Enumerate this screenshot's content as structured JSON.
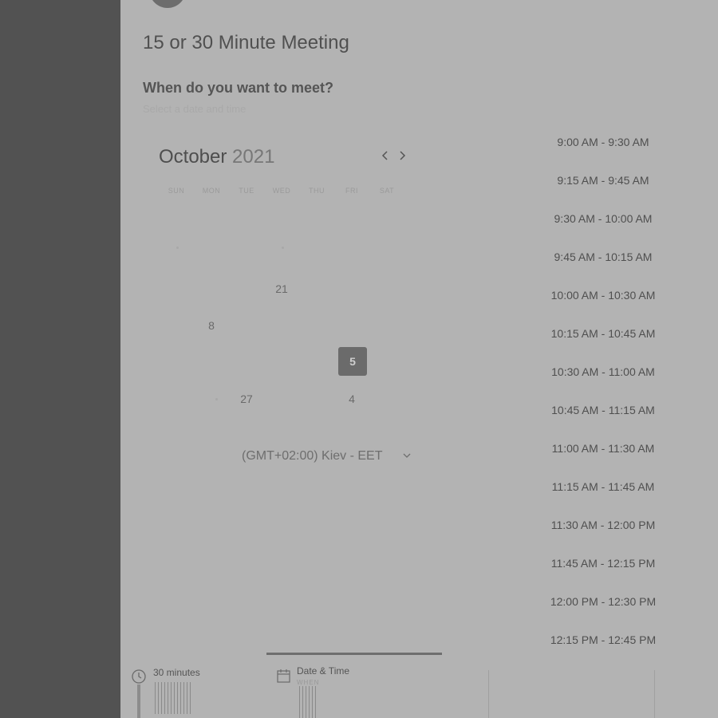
{
  "meeting": {
    "title": "15 or 30 Minute Meeting",
    "question": "When do you want to meet?",
    "hint": "Select a date and time"
  },
  "calendar": {
    "month": "October",
    "year": "2021",
    "prev_icon": "chevron-left",
    "next_icon": "chevron-right",
    "weekdays": [
      "SUN",
      "MON",
      "TUE",
      "WED",
      "THU",
      "FRI",
      "SAT"
    ],
    "visible_days": [
      "21",
      "8",
      "5",
      "27",
      "4"
    ],
    "selected_day": "5",
    "timezone": "(GMT+02:00) Kiev - EET",
    "timezone_icon": "chevron-down"
  },
  "slots": [
    "9:00 AM - 9:30 AM",
    "9:15 AM - 9:45 AM",
    "9:30 AM - 10:00 AM",
    "9:45 AM - 10:15 AM",
    "10:00 AM - 10:30 AM",
    "10:15 AM - 10:45 AM",
    "10:30 AM - 11:00 AM",
    "10:45 AM - 11:15 AM",
    "11:00 AM - 11:30 AM",
    "11:15 AM - 11:45 AM",
    "11:30 AM - 12:00 PM",
    "11:45 AM - 12:15 PM",
    "12:00 PM - 12:30 PM",
    "12:15 PM - 12:45 PM"
  ],
  "steps": [
    {
      "label": "30 minutes",
      "icon": "clock"
    },
    {
      "label": "Date & Time",
      "sublabel": "WHEN",
      "icon": "calendar"
    }
  ],
  "colors": {
    "sidebar": "#525252",
    "background": "#b3b3b3",
    "selected_day": "#6b6b6b"
  }
}
